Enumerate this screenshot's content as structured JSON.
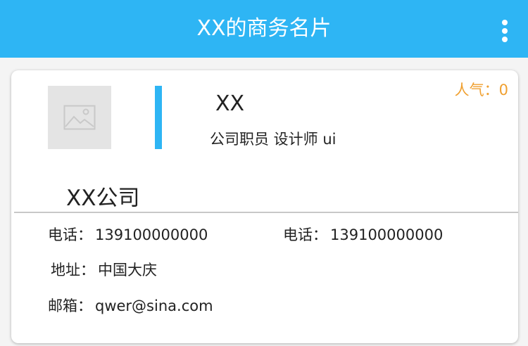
{
  "header": {
    "title": "XX的商务名片",
    "menu_icon": "more-vertical-icon"
  },
  "card": {
    "avatar_icon": "image-placeholder-icon",
    "popularity": "人气：0",
    "name": "XX",
    "position": "公司职员  设计师 ui",
    "company": "XX公司",
    "phone1_label": "电话：",
    "phone1_value": "139100000000",
    "phone2_label": "电话：",
    "phone2_value": "139100000000",
    "address_label": "地址：",
    "address_value": "中国大庆",
    "email_label": "邮箱：",
    "email_value": "qwer@sina.com"
  },
  "colors": {
    "primary": "#2eb5f4",
    "popularity": "#f0a030",
    "text": "#222222"
  }
}
